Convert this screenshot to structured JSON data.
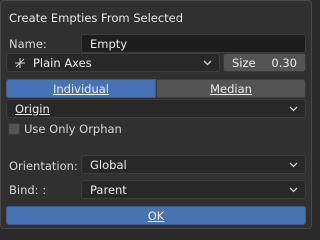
{
  "title": "Create Empties From Selected",
  "name": {
    "label": "Name:",
    "value": "Empty"
  },
  "display_type": {
    "value": "Plain Axes",
    "icon": "plain-axes-icon"
  },
  "size": {
    "label": "Size",
    "value": "0.30"
  },
  "mode": {
    "options": [
      "Individual",
      "Median"
    ],
    "selected": "Individual"
  },
  "location": {
    "value": "Origin"
  },
  "use_only_orphan": {
    "label": "Use Only Orphan",
    "checked": false
  },
  "orientation": {
    "label": "Orientation:",
    "value": "Global"
  },
  "bind": {
    "label": "Bind: :",
    "value": "Parent"
  },
  "ok_label": "OK",
  "colors": {
    "accent": "#4772b3",
    "panel": "#303030",
    "field": "#1d1d1d",
    "button": "#545454"
  }
}
